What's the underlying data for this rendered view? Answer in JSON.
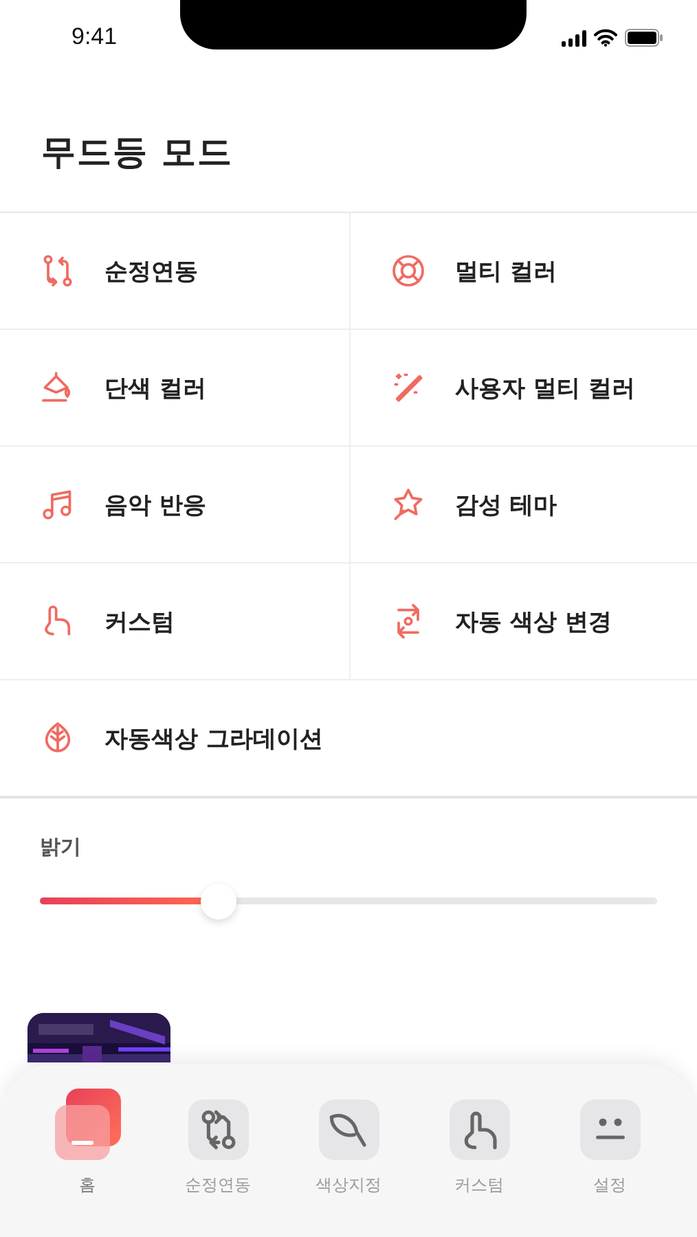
{
  "status_bar": {
    "time": "9:41"
  },
  "title": "무드등 모드",
  "modes": [
    {
      "label": "순정연동"
    },
    {
      "label": "멀티 컬러"
    },
    {
      "label": "단색 컬러"
    },
    {
      "label": "사용자 멀티 컬러"
    },
    {
      "label": "음악 반응"
    },
    {
      "label": "감성 테마"
    },
    {
      "label": "커스텀"
    },
    {
      "label": "자동 색상 변경"
    },
    {
      "label": "자동색상 그라데이션"
    }
  ],
  "brightness": {
    "label": "밝기",
    "level": 0.29
  },
  "tab_bar": [
    {
      "label": "홈",
      "selected": true
    },
    {
      "label": "순정연동",
      "selected": false
    },
    {
      "label": "색상지정",
      "selected": false
    },
    {
      "label": "커스텀",
      "selected": false
    },
    {
      "label": "설정",
      "selected": false
    }
  ]
}
